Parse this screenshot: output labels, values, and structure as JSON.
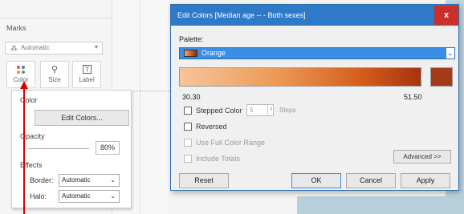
{
  "marks": {
    "title": "Marks",
    "mark_type": "Automatic",
    "buttons": [
      {
        "label": "Color",
        "icon": "color-dots-icon"
      },
      {
        "label": "Size",
        "icon": "size-icon"
      },
      {
        "label": "Label",
        "icon": "label-icon"
      }
    ]
  },
  "color_popup": {
    "color_label": "Color",
    "edit_colors_button": "Edit Colors...",
    "opacity_label": "Opacity",
    "opacity_value": "80%",
    "effects_label": "Effects",
    "border_label": "Border:",
    "border_value": "Automatic",
    "halo_label": "Halo:",
    "halo_value": "Automatic"
  },
  "dialog": {
    "title": "Edit Colors [Median age -- - Both sexes]",
    "close_label": "x",
    "palette_label": "Palette:",
    "palette_value": "Orange",
    "min_value": "30.30",
    "max_value": "51.50",
    "stepped_color_label": "Stepped Color",
    "steps_value": "5",
    "steps_label": "Steps",
    "reversed_label": "Reversed",
    "full_range_label": "Use Full Color Range",
    "include_totals_label": "Include Totals",
    "advanced_button": "Advanced >>",
    "reset_button": "Reset",
    "ok_button": "OK",
    "cancel_button": "Cancel",
    "apply_button": "Apply"
  },
  "colors": {
    "titlebar": "#2f7ac8",
    "close": "#c9302c",
    "palette_highlight": "#3a8ee6",
    "gradient_start": "#f6c59a",
    "gradient_end": "#a7320f",
    "end_swatch": "#a43a17",
    "annotation_arrow": "#e00000"
  }
}
